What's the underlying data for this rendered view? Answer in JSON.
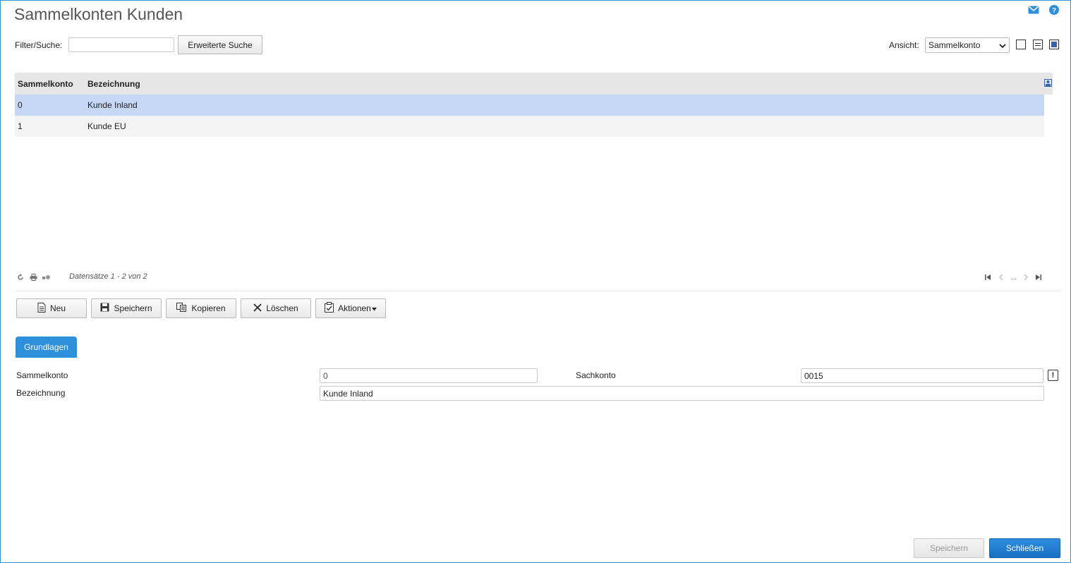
{
  "window": {
    "title": "Sammelkonten Kunden"
  },
  "top_icons": {
    "mail": "mail-icon",
    "help": "help-icon"
  },
  "filter": {
    "label": "Filter/Suche:",
    "value": "",
    "extended_search_label": "Erweiterte Suche"
  },
  "view": {
    "label": "Ansicht:",
    "selected": "Sammelkonto",
    "options": [
      "Sammelkonto"
    ]
  },
  "grid": {
    "columns": [
      "Sammelkonto",
      "Bezeichnung"
    ],
    "rows": [
      {
        "konto": "0",
        "bezeichnung": "Kunde Inland",
        "selected": true
      },
      {
        "konto": "1",
        "bezeichnung": "Kunde EU",
        "selected": false
      }
    ],
    "record_info": "Datensätze 1 - 2 von 2",
    "pager_ellipsis": "..."
  },
  "toolbar": {
    "new_label": "Neu",
    "save_label": "Speichern",
    "copy_label": "Kopieren",
    "delete_label": "Löschen",
    "actions_label": "Aktionen"
  },
  "tabs": [
    "Grundlagen"
  ],
  "form": {
    "sammelkonto_label": "Sammelkonto",
    "sammelkonto_value": "0",
    "sachkonto_label": "Sachkonto",
    "sachkonto_value": "0015",
    "bezeichnung_label": "Bezeichnung",
    "bezeichnung_value": "Kunde Inland"
  },
  "footer": {
    "save_label": "Speichern",
    "close_label": "Schließen"
  },
  "colors": {
    "accent": "#2e8fdb",
    "selected_row": "#c6d8f6",
    "header_bg": "#e6e6e6"
  }
}
